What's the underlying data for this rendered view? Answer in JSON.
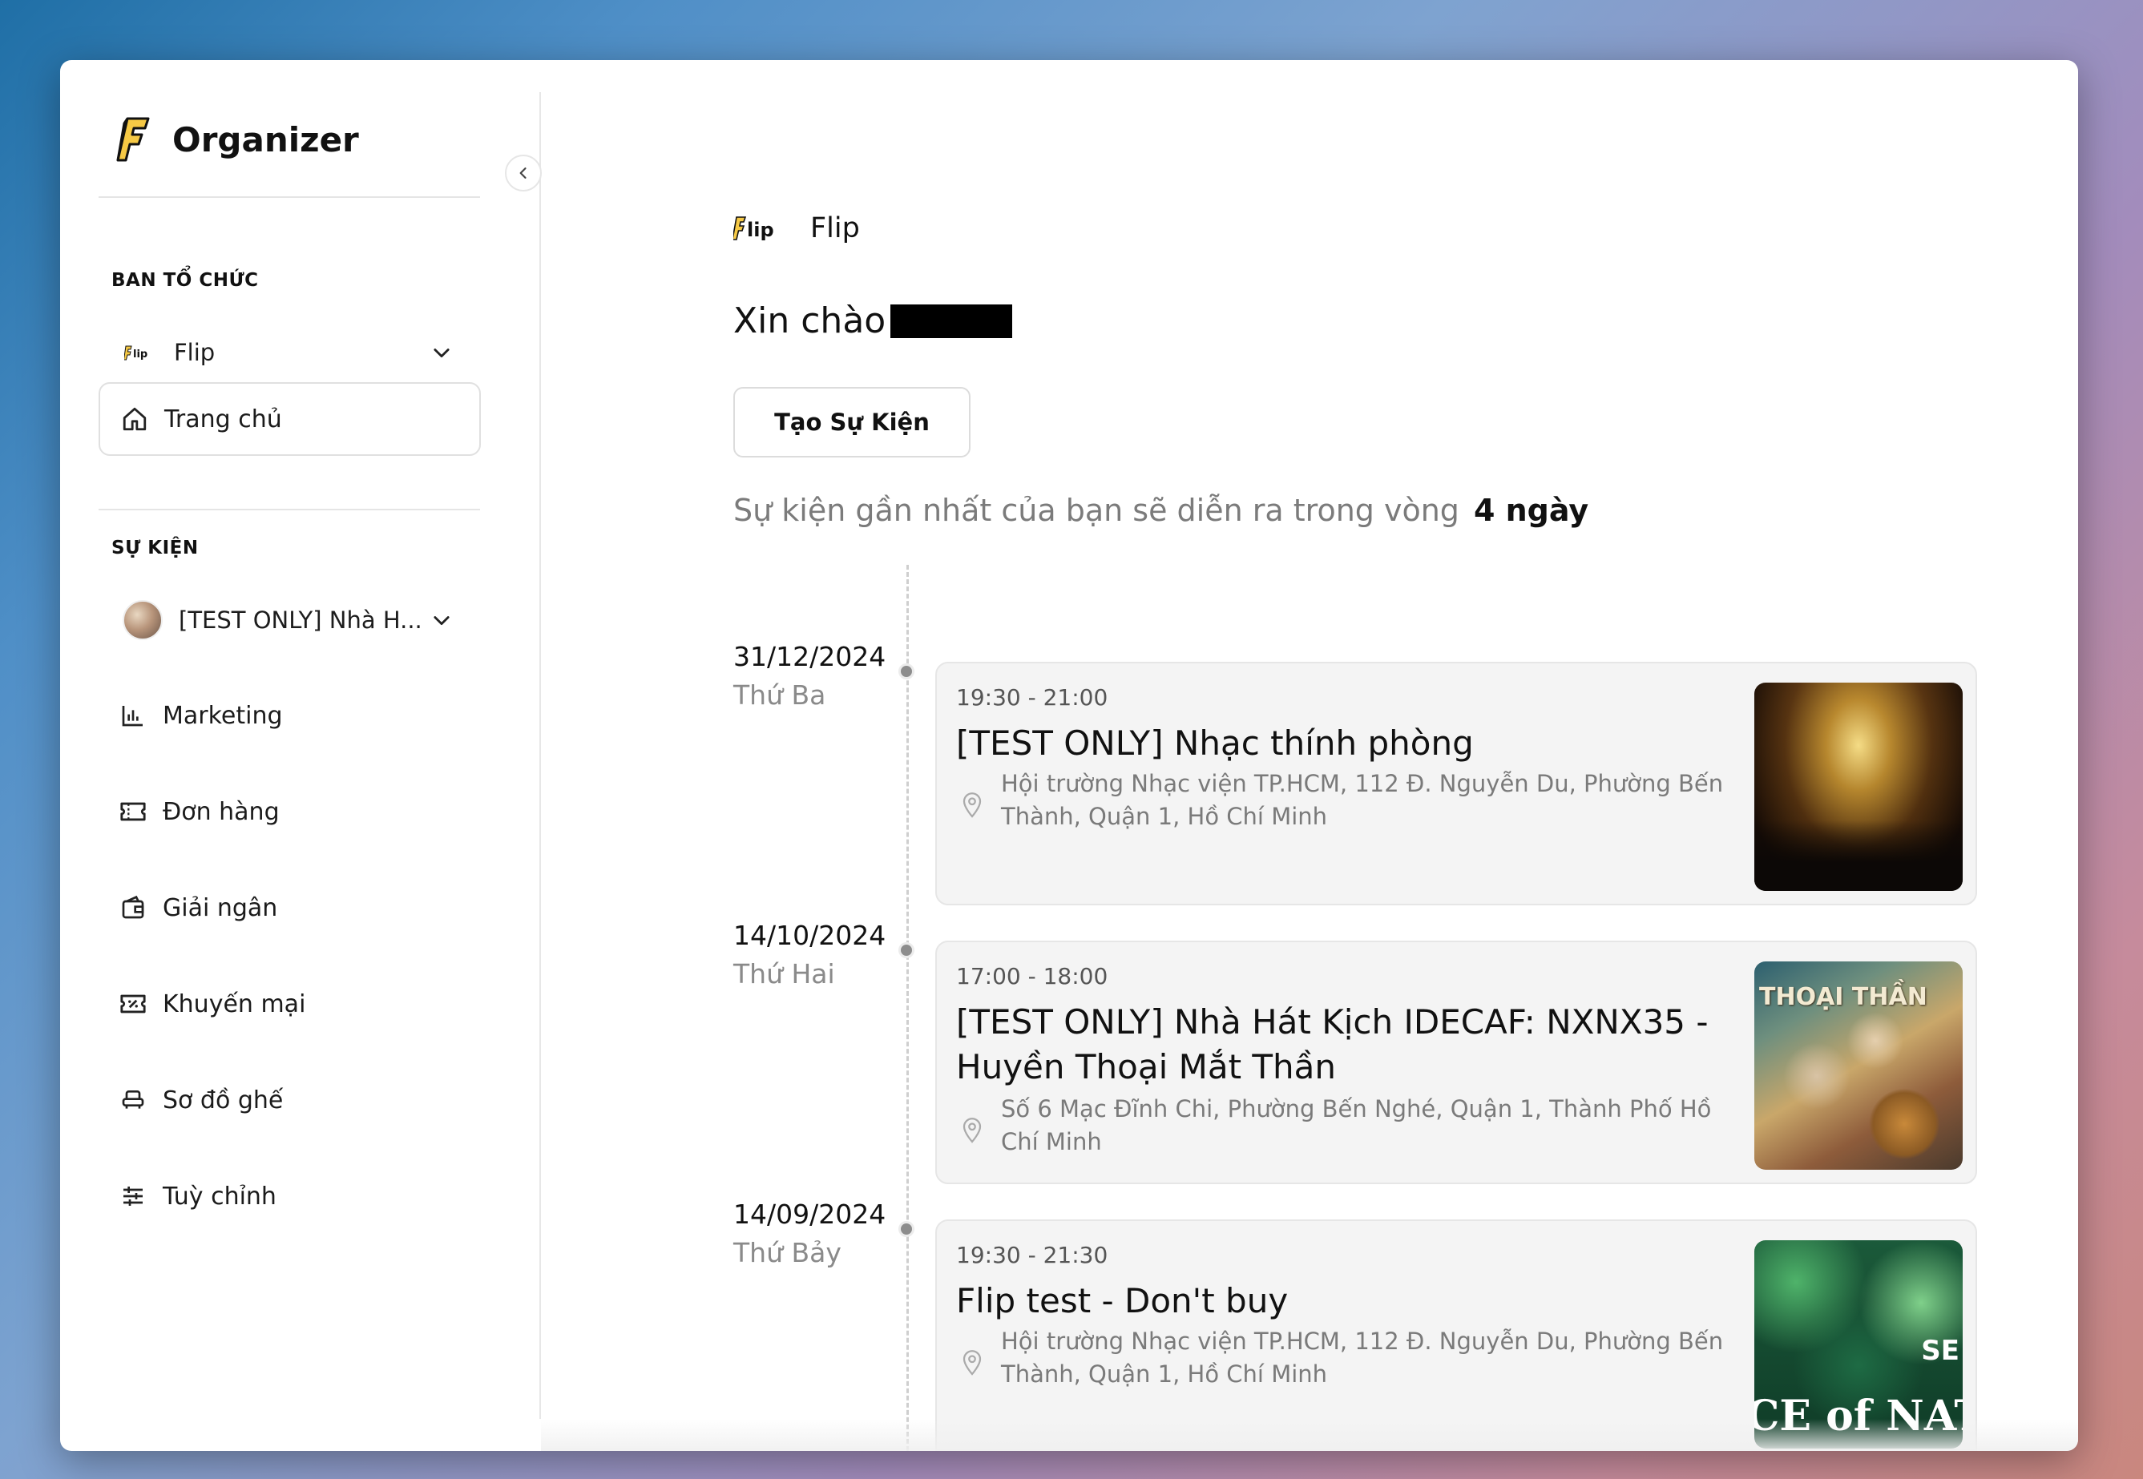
{
  "sidebar": {
    "brand": "Organizer",
    "org_section_label": "BAN TỔ CHỨC",
    "selected_org": "Flip",
    "home_label": "Trang chủ",
    "events_section_label": "SỰ KIỆN",
    "selected_event": "[TEST ONLY] Nhà H...",
    "nav": [
      {
        "label": "Marketing",
        "icon": "bar-chart-icon"
      },
      {
        "label": "Đơn hàng",
        "icon": "ticket-icon"
      },
      {
        "label": "Giải ngân",
        "icon": "wallet-icon"
      },
      {
        "label": "Khuyến mại",
        "icon": "coupon-icon"
      },
      {
        "label": "Sơ đồ ghế",
        "icon": "seat-icon"
      },
      {
        "label": "Tuỳ chỉnh",
        "icon": "sliders-icon"
      }
    ]
  },
  "main": {
    "org_name": "Flip",
    "greeting": "Xin chào",
    "create_button": "Tạo Sự Kiện",
    "upcoming_text": "Sự kiện gần nhất của bạn sẽ diễn ra trong vòng",
    "upcoming_days": "4 ngày",
    "events": [
      {
        "date": "31/12/2024",
        "weekday": "Thứ Ba",
        "time": "19:30 - 21:00",
        "title": "[TEST ONLY] Nhạc thính phòng",
        "address": "Hội trường Nhạc viện TP.HCM, 112 Đ. Nguyễn Du, Phường Bến Thành, Quận 1, Hồ Chí Minh"
      },
      {
        "date": "14/10/2024",
        "weekday": "Thứ Hai",
        "time": "17:00 - 18:00",
        "title": "[TEST ONLY] Nhà Hát Kịch IDECAF: NXNX35 - Huyền Thoại Mắt Thần",
        "address": "Số 6 Mạc Đĩnh Chi, Phường Bến Nghé, Quận 1, Thành Phố Hồ Chí Minh",
        "poster_text": "THOẠI THẦN"
      },
      {
        "date": "14/09/2024",
        "weekday": "Thứ Bảy",
        "time": "19:30 - 21:30",
        "title": "Flip test - Don't buy",
        "address": "Hội trường Nhạc viện TP.HCM, 112 Đ. Nguyễn Du, Phường Bến Thành, Quận 1, Hồ Chí Minh",
        "poster_text": "CE of NAT",
        "poster_top": "SE"
      }
    ]
  },
  "colors": {
    "accent_yellow": "#f6c945",
    "text_primary": "#111111",
    "text_muted": "#7a7a7a",
    "card_bg": "#f4f4f4"
  }
}
